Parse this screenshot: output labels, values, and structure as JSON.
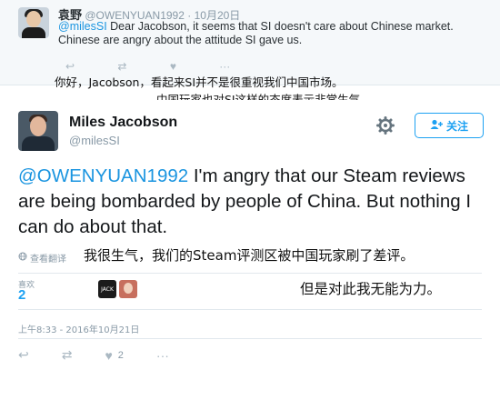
{
  "reply_tweet": {
    "name": "袁野",
    "handle": "@OWENYUAN1992",
    "date": "10月20日",
    "mention": "@milesSI",
    "text_line1": " Dear Jacobson, it seems that SI doesn't care about Chinese market.",
    "text_line2": "Chinese are angry about the attitude SI gave us.",
    "annotation_line1": "你好，Jacobson，看起来SI并不是很重视我们中国市场。",
    "annotation_line2": "中国玩家也对SI这样的态度表示非常生气。"
  },
  "main_tweet": {
    "name": "Miles Jacobson",
    "handle": "@milesSI",
    "follow_label": "关注",
    "mention": "@OWENYUAN1992",
    "text": " I'm angry that our Steam reviews are being bombarded by people of China. But nothing I can do about that.",
    "translate_label": "查看翻译",
    "annotation_line1": "我很生气，我们的Steam评测区被中国玩家刷了差评。",
    "annotation_line2": "但是对此我无能为力。",
    "likes_label": "喜欢",
    "likes_count": "2",
    "liker1_text": "JACK",
    "timestamp": "上午8:33 - 2016年10月21日",
    "reply_count": "",
    "retweet_count": "",
    "like_count": "2"
  },
  "colors": {
    "accent": "#1da1f2",
    "mention": "#1b95e0",
    "muted": "#8899a6"
  },
  "icons": [
    "reply-icon",
    "retweet-icon",
    "like-icon",
    "more-icon",
    "gear-icon",
    "follow-user-icon",
    "globe-icon"
  ]
}
